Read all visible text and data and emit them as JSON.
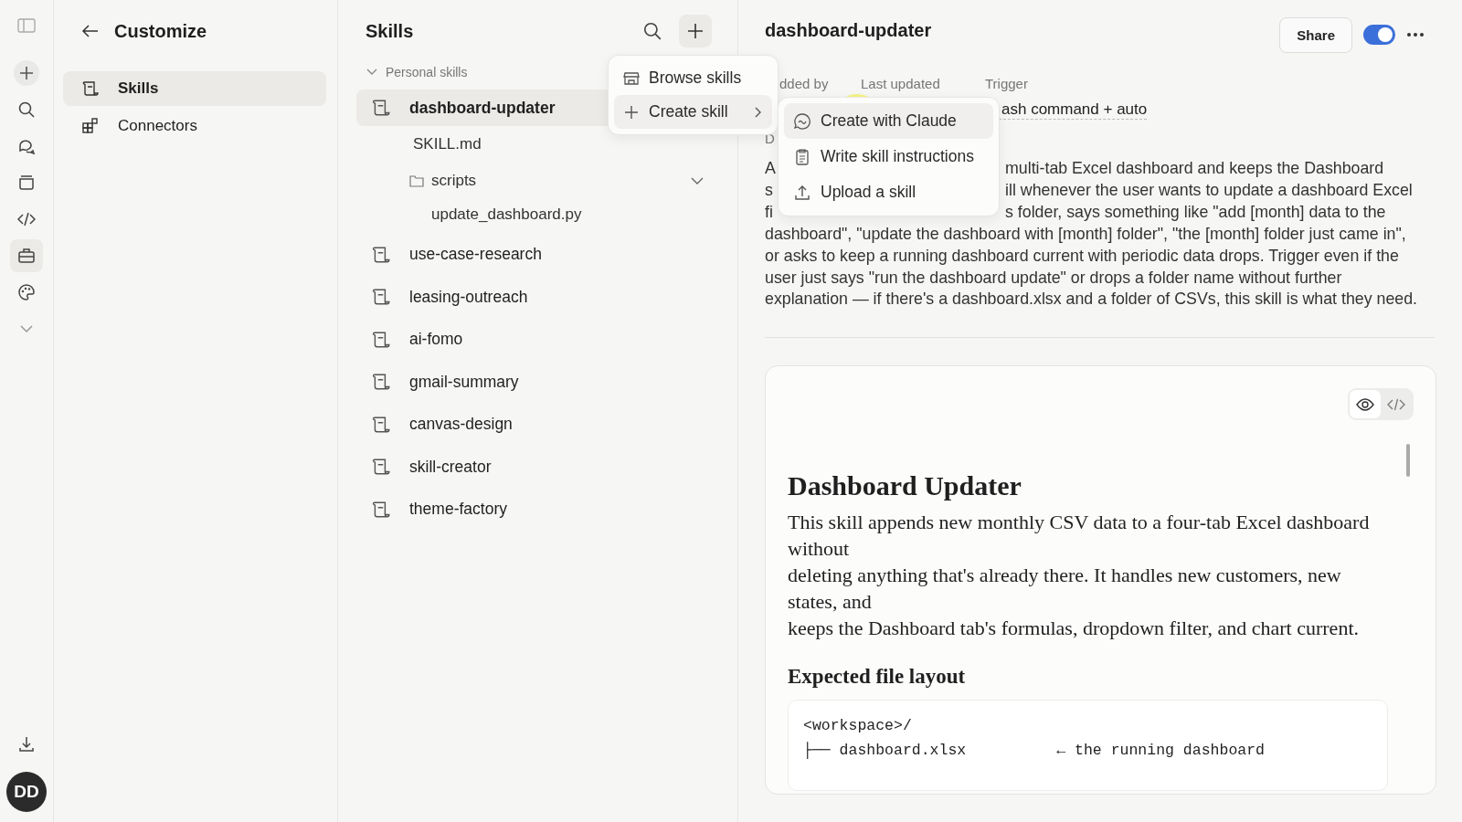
{
  "rail": {
    "items": [
      {
        "kind": "new",
        "selected": false
      },
      {
        "kind": "search",
        "selected": false
      },
      {
        "kind": "chats",
        "selected": false
      },
      {
        "kind": "projects",
        "selected": false
      },
      {
        "kind": "code",
        "selected": false
      },
      {
        "kind": "toolbox",
        "selected": true
      },
      {
        "kind": "palette",
        "selected": false
      },
      {
        "kind": "more",
        "selected": false
      }
    ],
    "avatar": "DD"
  },
  "customize": {
    "title": "Customize",
    "nav": [
      {
        "label": "Skills",
        "kind": "skills",
        "selected": true
      },
      {
        "label": "Connectors",
        "kind": "connectors",
        "selected": false
      }
    ]
  },
  "skills": {
    "title": "Skills",
    "section": {
      "label": "Personal skills",
      "expanded": true
    },
    "items": [
      {
        "name": "dashboard-updater",
        "selected": true,
        "children": [
          {
            "name": "SKILL.md",
            "kind": "file"
          },
          {
            "name": "scripts",
            "kind": "folder",
            "expanded": true,
            "children": [
              {
                "name": "update_dashboard.py",
                "kind": "file"
              }
            ]
          }
        ]
      },
      {
        "name": "use-case-research",
        "selected": false
      },
      {
        "name": "leasing-outreach",
        "selected": false
      },
      {
        "name": "ai-fomo",
        "selected": false
      },
      {
        "name": "gmail-summary",
        "selected": false
      },
      {
        "name": "canvas-design",
        "selected": false
      },
      {
        "name": "skill-creator",
        "selected": false
      },
      {
        "name": "theme-factory",
        "selected": false
      }
    ]
  },
  "menu": {
    "items": [
      {
        "label": "Browse skills",
        "kind": "browse",
        "selected": false,
        "submenu": false
      },
      {
        "label": "Create skill",
        "kind": "create",
        "selected": true,
        "submenu": true
      }
    ]
  },
  "submenu": {
    "items": [
      {
        "label": "Create with Claude",
        "kind": "claude",
        "selected": true
      },
      {
        "label": "Write skill instructions",
        "kind": "write",
        "selected": false
      },
      {
        "label": "Upload a skill",
        "kind": "upload",
        "selected": false
      }
    ]
  },
  "detail": {
    "title": "dashboard-updater",
    "share": "Share",
    "enabled": true,
    "meta": [
      {
        "label": "dded by"
      },
      {
        "label": "Last updated"
      },
      {
        "label": "Trigger",
        "value": "ash command + auto"
      }
    ],
    "description_label": "D",
    "description_fragments": [
      {
        "left": "A",
        "right": "multi-tab Excel dashboard and keeps the Dashboard"
      },
      {
        "left": "s",
        "right": "ill whenever the user wants to update a dashboard Excel"
      },
      {
        "left": "fi",
        "right": "s folder, says something like \"add [month] data to the"
      }
    ],
    "description_rest": "dashboard\", \"update the dashboard with [month] folder\", \"the [month] folder just came in\", or asks to keep a running dashboard current with periodic data drops. Trigger even if the user just says \"run the dashboard update\" or drops a folder name without further explanation — if there's a dashboard.xlsx and a folder of CSVs, this skill is what they need.",
    "view_modes": [
      {
        "kind": "preview",
        "selected": true
      },
      {
        "kind": "code",
        "selected": false
      }
    ],
    "doc": {
      "heading": "Dashboard Updater",
      "paragraph_lines": [
        "This skill appends new monthly CSV data to a four-tab Excel dashboard without",
        "deleting anything that's already there. It handles new customers, new states, and",
        "keeps the Dashboard tab's formulas, dropdown filter, and chart current."
      ],
      "subheading": "Expected file layout",
      "code_lines": [
        "<workspace>/",
        "├── dashboard.xlsx          ← the running dashboard"
      ]
    }
  }
}
